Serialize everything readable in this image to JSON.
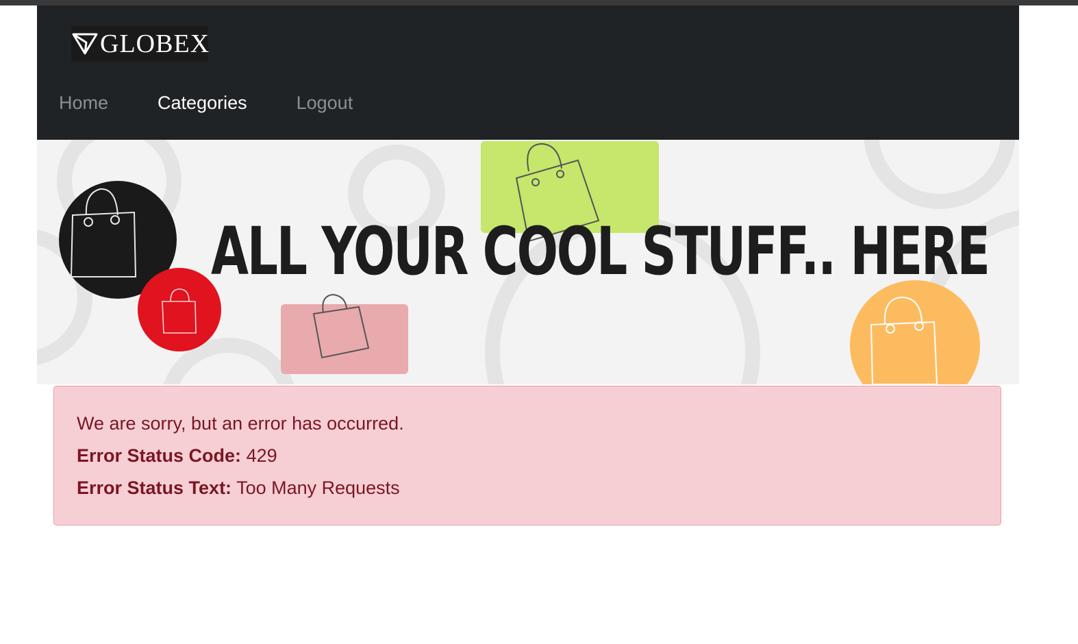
{
  "brand": {
    "name": "GLOBEX",
    "logo_icon": "paper-plane-icon"
  },
  "nav": {
    "items": [
      {
        "label": "Home",
        "active": false
      },
      {
        "label": "Categories",
        "active": true
      },
      {
        "label": "Logout",
        "active": false
      }
    ]
  },
  "hero": {
    "title": "ALL YOUR COOL STUFF.. HERE",
    "icons": [
      "shopping-bag-icon"
    ],
    "colors": {
      "black": "#1a1a1a",
      "red": "#e0131f",
      "green": "#c6e66c",
      "pink": "#e8aaad",
      "orange": "#fdbb5f",
      "rings": "#e4e4e4"
    }
  },
  "error": {
    "message": "We are sorry, but an error has occurred.",
    "status_code_label": "Error Status Code:",
    "status_code_value": "429",
    "status_text_label": "Error Status Text:",
    "status_text_value": "Too Many Requests"
  },
  "colors": {
    "navbar_bg": "#202325",
    "alert_bg": "#f6cfd4",
    "alert_border": "#ef9aa6",
    "alert_text": "#7a1624"
  }
}
